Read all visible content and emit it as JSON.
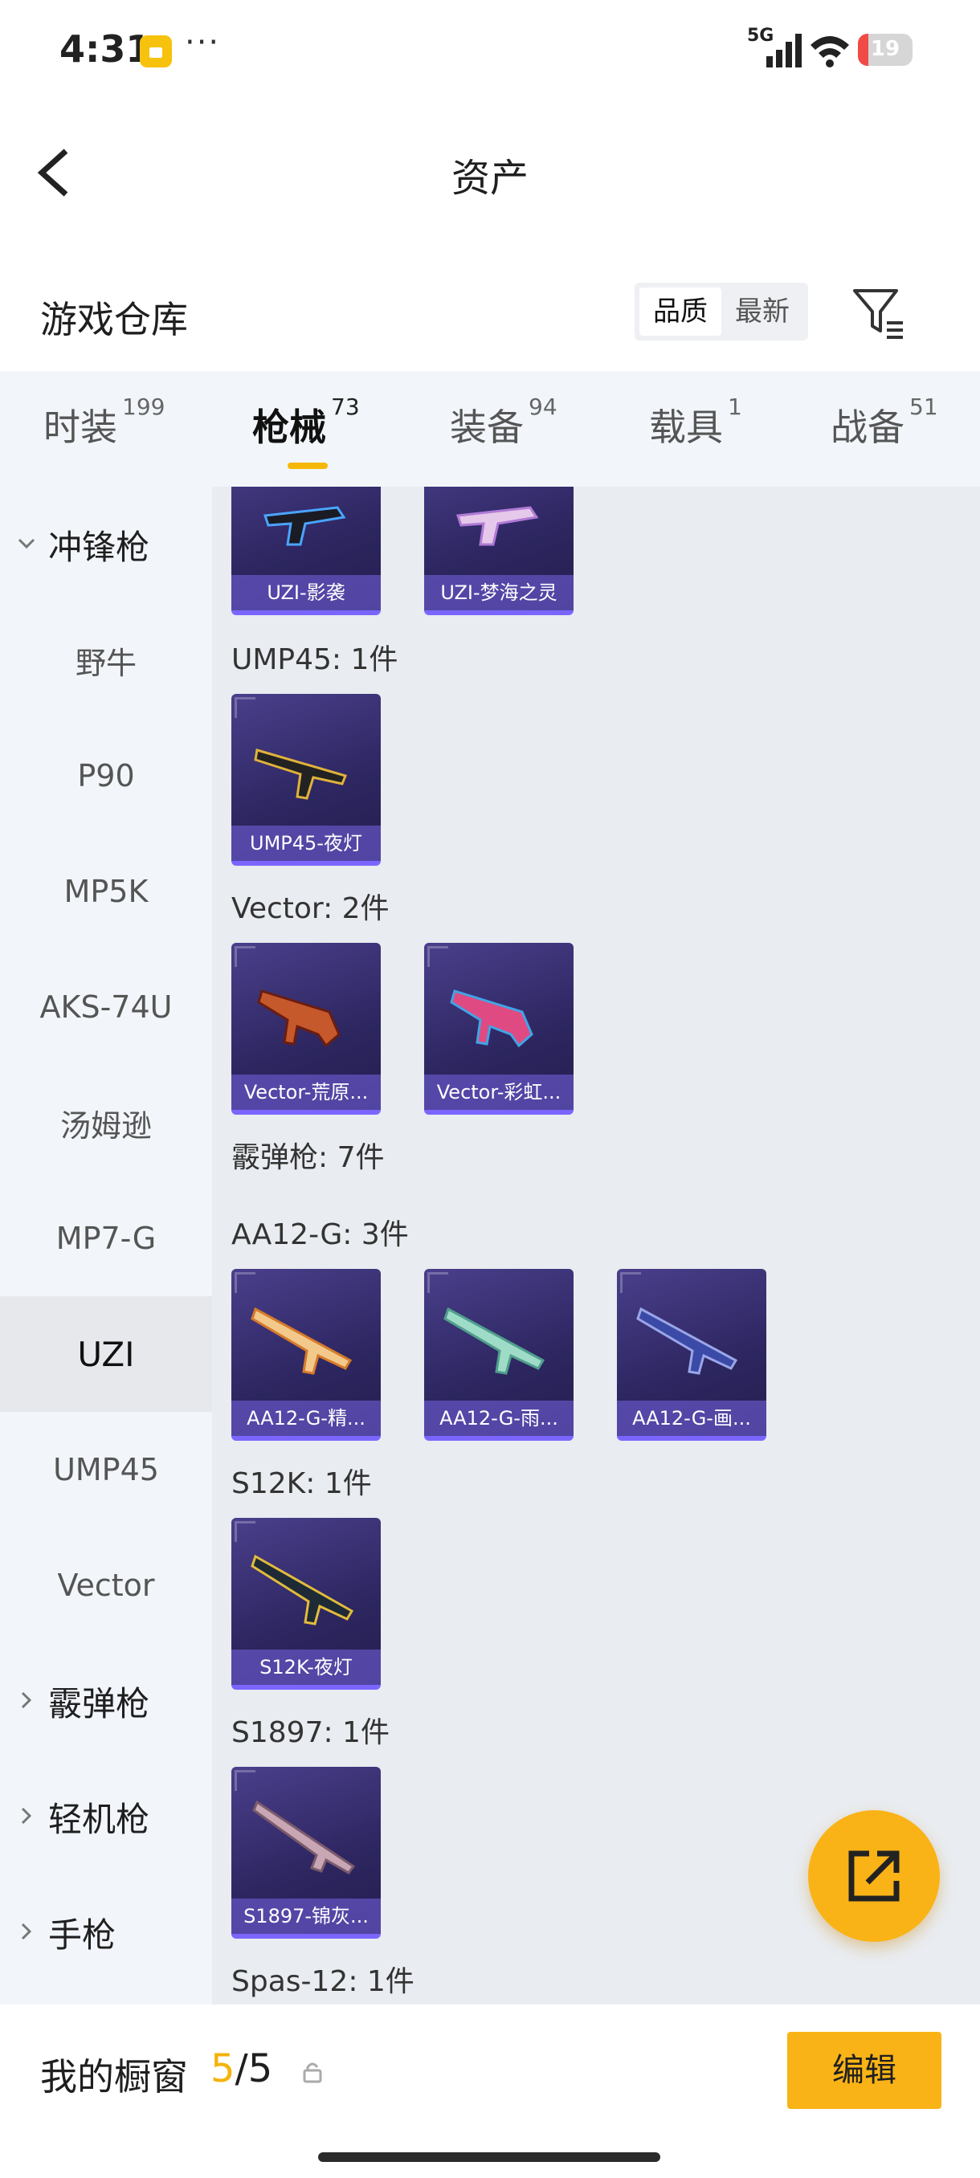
{
  "status_bar": {
    "time": "4:31",
    "more": "···",
    "network": "5G",
    "battery": "19",
    "battery_level": 0.19
  },
  "header": {
    "title": "资产"
  },
  "section": {
    "label": "游戏仓库",
    "sort_options": [
      "品质",
      "最新"
    ],
    "sort_selected": "品质"
  },
  "tabs": [
    {
      "label": "时装",
      "count": "199"
    },
    {
      "label": "枪械",
      "count": "73",
      "active": true
    },
    {
      "label": "装备",
      "count": "94"
    },
    {
      "label": "载具",
      "count": "1"
    },
    {
      "label": "战备",
      "count": "51"
    }
  ],
  "sidebar": {
    "items": [
      {
        "label": "冲锋枪",
        "type": "category",
        "expanded": true
      },
      {
        "label": "野牛"
      },
      {
        "label": "P90"
      },
      {
        "label": "MP5K"
      },
      {
        "label": "AKS-74U"
      },
      {
        "label": "汤姆逊"
      },
      {
        "label": "MP7-G"
      },
      {
        "label": "UZI",
        "selected": true
      },
      {
        "label": "UMP45"
      },
      {
        "label": "Vector"
      },
      {
        "label": "霰弹枪",
        "type": "category"
      },
      {
        "label": "轻机枪",
        "type": "category"
      },
      {
        "label": "手枪",
        "type": "category"
      }
    ]
  },
  "content": {
    "top_cards": [
      "UZI-影袭",
      "UZI-梦海之灵"
    ],
    "groups": [
      {
        "title": "UMP45: 1件",
        "cards": [
          "UMP45-夜灯"
        ]
      },
      {
        "title": "Vector: 2件",
        "cards": [
          "Vector-荒原...",
          "Vector-彩虹..."
        ]
      },
      {
        "title": "霰弹枪: 7件",
        "cards": []
      },
      {
        "title": "AA12-G: 3件",
        "cards": [
          "AA12-G-精...",
          "AA12-G-雨...",
          "AA12-G-画..."
        ]
      },
      {
        "title": "S12K: 1件",
        "cards": [
          "S12K-夜灯"
        ]
      },
      {
        "title": "S1897: 1件",
        "cards": [
          "S1897-锦灰..."
        ]
      },
      {
        "title": "Spas-12: 1件",
        "cards": []
      }
    ]
  },
  "bottom": {
    "label": "我的橱窗",
    "current": "5",
    "separator": "/",
    "total": "5",
    "edit_label": "编辑"
  },
  "colors": {
    "accent": "#f9b316",
    "card_bg": "#2d2660",
    "card_border": "#7a66ff",
    "sidebar_bg": "#f2f6fa",
    "content_bg": "#e9ecf0"
  }
}
